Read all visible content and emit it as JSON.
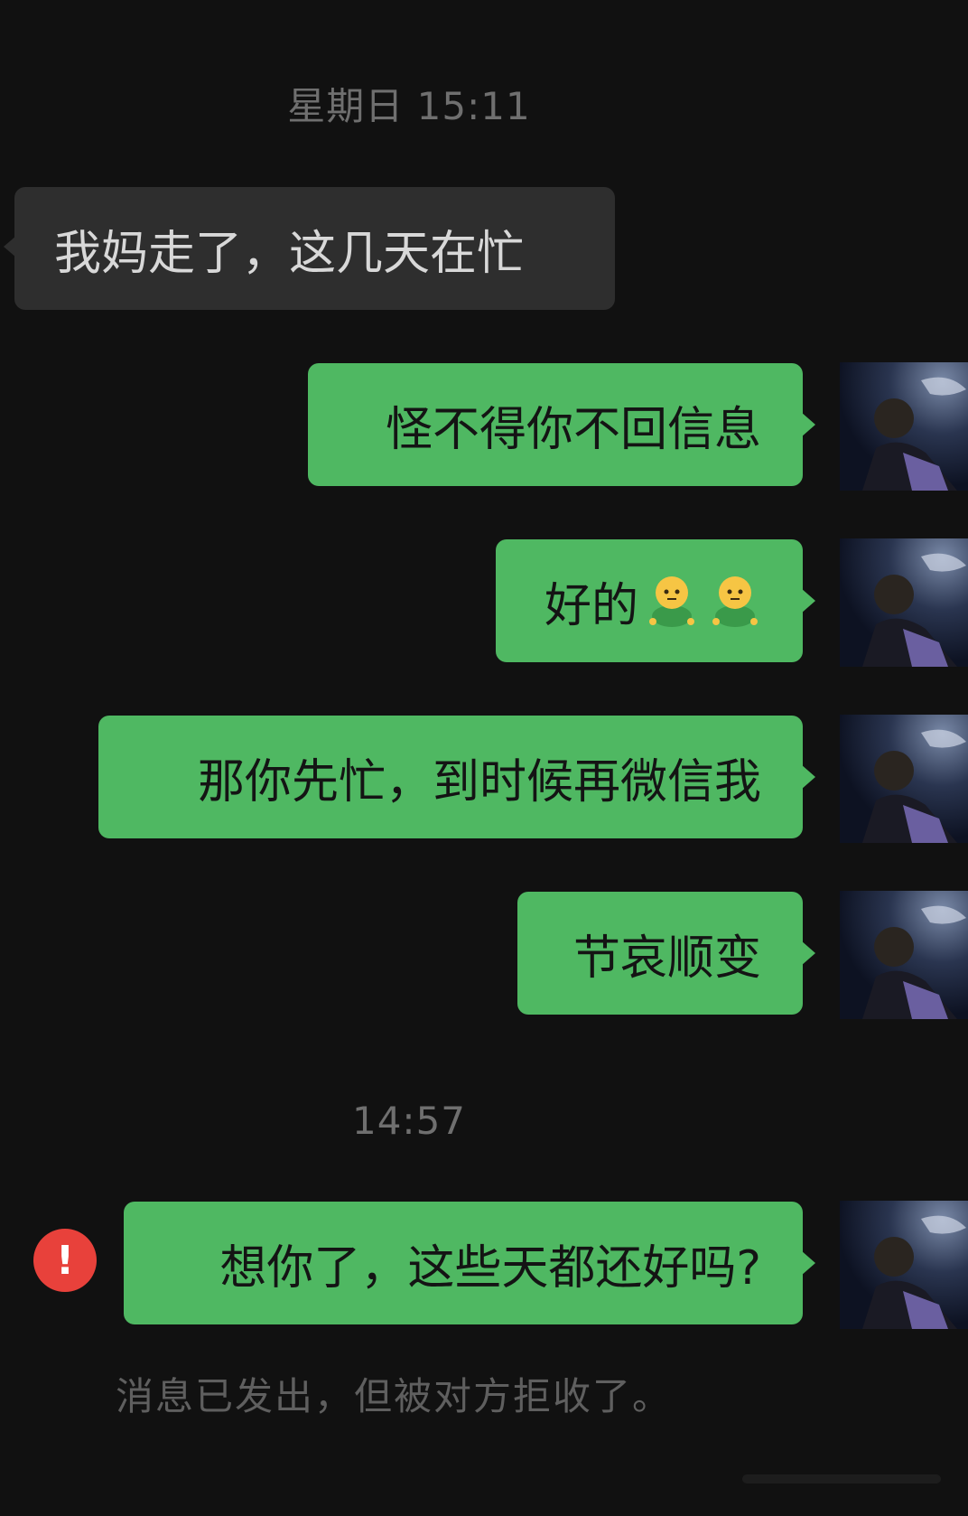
{
  "chat": {
    "timestamp_1": "星期日 15:11",
    "timestamp_2": "14:57",
    "messages": [
      {
        "side": "in",
        "text": "我妈走了，这几天在忙"
      },
      {
        "side": "out",
        "text": "怪不得你不回信息"
      },
      {
        "side": "out",
        "text": "好的",
        "emoji": [
          "smile-doll-emoji",
          "smile-doll-emoji"
        ]
      },
      {
        "side": "out",
        "text": "那你先忙，到时候再微信我"
      },
      {
        "side": "out",
        "text": "节哀顺变"
      },
      {
        "side": "out",
        "text": "想你了，这些天都还好吗?",
        "status": "error"
      }
    ],
    "error_icon_glyph": "!",
    "system_notice": "消息已发出，但被对方拒收了。"
  },
  "colors": {
    "background": "#111111",
    "incoming_bubble": "#2e2e2e",
    "outgoing_bubble": "#4fb862",
    "error": "#e8413b",
    "muted_text": "#6f6f6f"
  }
}
